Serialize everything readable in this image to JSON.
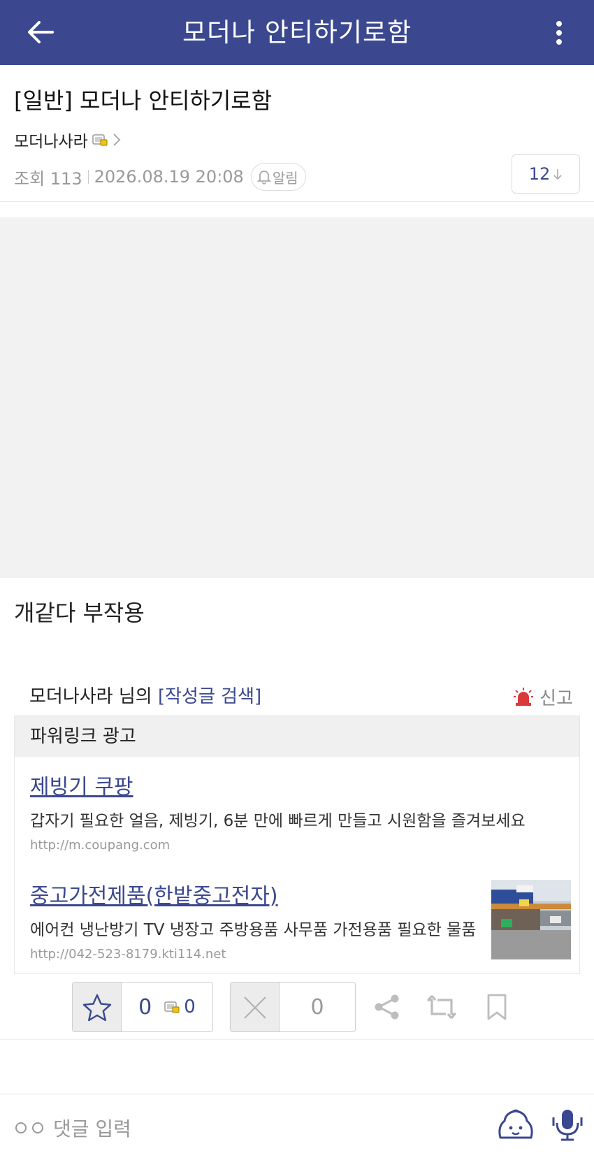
{
  "header": {
    "title": "모더나 안티하기로함"
  },
  "post": {
    "title": "[일반] 모더나 안티하기로함",
    "author": "모더나사라",
    "views_label": "조회 113",
    "datetime": "2026.08.19 20:08",
    "alarm_label": "알림",
    "comment_count": "12",
    "body": "개같다 부작용"
  },
  "writer_search": {
    "name": "모더나사라 님의 ",
    "link": "[작성글 검색]",
    "report_label": "신고"
  },
  "ads": {
    "header": "파워링크 광고",
    "items": [
      {
        "title": "제빙기 쿠팡",
        "desc": "갑자기 필요한 얼음, 제빙기, 6분 만에 빠르게 만들고 시원함을 즐겨보세요",
        "url": "http://m.coupang.com"
      },
      {
        "title": "중고가전제품(한밭중고전자)",
        "desc": "에어컨 냉난방기 TV 냉장고 주방용품 사무품 가전용품 필요한 물품",
        "url": "http://042-523-8179.kti114.net"
      }
    ]
  },
  "actions": {
    "recommend_count": "0",
    "recommend_fixed_count": "0",
    "downvote_count": "0"
  },
  "comment_bar": {
    "placeholder": "댓글 입력"
  },
  "colors": {
    "brand": "#3b4890",
    "report_red": "#d93a3a"
  },
  "icons": [
    "back-arrow-icon",
    "more-vertical-icon",
    "fixed-nick-icon",
    "chevron-right-icon",
    "bell-icon",
    "arrow-down-icon",
    "siren-icon",
    "star-icon",
    "x-icon",
    "share-icon",
    "repost-icon",
    "bookmark-icon",
    "emoticon-icon",
    "mic-icon"
  ]
}
